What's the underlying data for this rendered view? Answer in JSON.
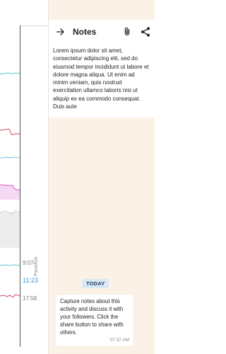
{
  "left_panel": {
    "pace_ticks": [
      "9:07",
      "11:23",
      "17:58"
    ],
    "pace_label": "Pace/km"
  },
  "notes": {
    "title": "Notes",
    "body_text": "Lorem ipsum dolor sit amet, consectetur adipiscing elit, sed do eiusmod tempor incididunt ut labore et dolore magna aliqua. Ut enim ad minim veniam, quis nostrud exercitation ullamco laboris nisi ut aliquip ex ea commodo consequat. Duis aute",
    "date_chip": "TODAY",
    "message": "Capture notes about this activity and discuss it with your followers. Click the share button to share with others.",
    "message_time": "07:37 AM"
  },
  "icons": {
    "back": "arrow-right-icon",
    "attach": "paperclip-icon",
    "share": "share-icon"
  },
  "colors": {
    "notes_background": "#fbf1e6",
    "date_chip_background": "#dbe9f6",
    "pace_accent": "#2b9be0"
  }
}
